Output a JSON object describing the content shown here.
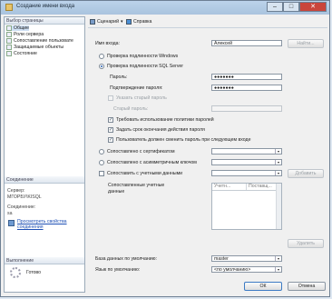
{
  "window": {
    "title": "Создание имени входа"
  },
  "sidebar": {
    "header": "Выбор страницы",
    "items": [
      "Общие",
      "Роли сервера",
      "Сопоставление пользовате",
      "Защищаемые объекты",
      "Состояние"
    ],
    "connection_header": "Соединение",
    "server_label": "Сервер:",
    "server_value": "МГОРБУ\\KISQL",
    "connection_label": "Соединение:",
    "connection_value": "sa",
    "view_props_link": "Просмотреть свойства соединения",
    "progress_header": "Выполнение",
    "progress_status": "Готово"
  },
  "toolbar": {
    "script_label": "Сценарий",
    "help_label": "Справка"
  },
  "form": {
    "login_label": "Имя входа:",
    "login_value": "Алексей",
    "search_button": "Найти...",
    "auth_windows": "Проверка подлинности Windows",
    "auth_sql": "Проверка подлинности SQL Server",
    "password_label": "Пароль:",
    "password_value": "●●●●●●●",
    "confirm_label": "Подтверждение пароля:",
    "confirm_value": "●●●●●●●",
    "specify_old": "Указать старый пароль",
    "old_password_label": "Старый пароль:",
    "enforce_policy": "Требовать использование политики паролей",
    "enforce_expiration": "Задать срок окончания действия пароля",
    "must_change": "Пользователь должен сменить пароль при следующем входе",
    "map_certificate": "Сопоставлено с сертификатом",
    "map_asym_key": "Сопоставлено с асимметричным ключом",
    "map_credential": "Сопоставить с учетными данными",
    "add_button": "Добавить",
    "mapped_creds_label": "Сопоставленные учетные данные",
    "grid_col1": "Учетн...",
    "grid_col2": "Поставщ...",
    "remove_button": "Удалить",
    "default_db_label": "База данных по умолчанию:",
    "default_db_value": "master",
    "default_lang_label": "Язык по умолчанию:",
    "default_lang_value": "<по умолчанию>"
  },
  "footer": {
    "ok": "ОК",
    "cancel": "Отмена"
  }
}
